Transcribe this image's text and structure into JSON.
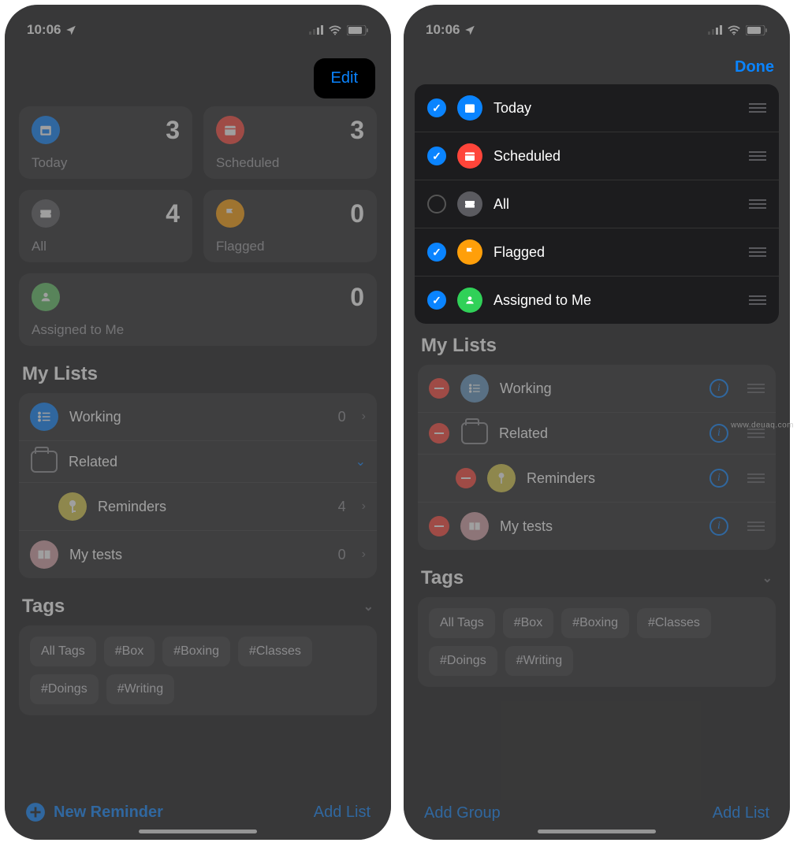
{
  "status": {
    "time": "10:06"
  },
  "left": {
    "nav": {
      "edit": "Edit"
    },
    "cards": {
      "today": {
        "label": "Today",
        "count": "3",
        "color": "#0a84ff"
      },
      "scheduled": {
        "label": "Scheduled",
        "count": "3",
        "color": "#ff453a"
      },
      "all": {
        "label": "All",
        "count": "4",
        "color": "#5b5b60"
      },
      "flagged": {
        "label": "Flagged",
        "count": "0",
        "color": "#ff9f0a"
      },
      "assigned": {
        "label": "Assigned to Me",
        "count": "0",
        "color": "#63c466"
      }
    },
    "mylists_title": "My Lists",
    "lists": {
      "working": {
        "label": "Working",
        "count": "0",
        "color": "#0a84ff"
      },
      "related": {
        "label": "Related"
      },
      "reminders": {
        "label": "Reminders",
        "count": "4",
        "color": "#d9c94a"
      },
      "mytests": {
        "label": "My tests",
        "count": "0",
        "color": "#d8a3a8"
      }
    },
    "tags_title": "Tags",
    "tags": [
      "All Tags",
      "#Box",
      "#Boxing",
      "#Classes",
      "#Doings",
      "#Writing"
    ],
    "bottom": {
      "new_reminder": "New Reminder",
      "add_list": "Add List"
    }
  },
  "right": {
    "nav": {
      "done": "Done"
    },
    "smart_lists": [
      {
        "key": "today",
        "label": "Today",
        "checked": true,
        "color": "#0a84ff"
      },
      {
        "key": "scheduled",
        "label": "Scheduled",
        "checked": true,
        "color": "#ff453a"
      },
      {
        "key": "all",
        "label": "All",
        "checked": false,
        "color": "#5b5b60"
      },
      {
        "key": "flagged",
        "label": "Flagged",
        "checked": true,
        "color": "#ff9f0a"
      },
      {
        "key": "assigned",
        "label": "Assigned to Me",
        "checked": true,
        "color": "#30d158"
      }
    ],
    "mylists_title": "My Lists",
    "lists": [
      {
        "key": "working",
        "label": "Working",
        "color": "#6597c3",
        "type": "list"
      },
      {
        "key": "related",
        "label": "Related",
        "type": "folder"
      },
      {
        "key": "reminders",
        "label": "Reminders",
        "color": "#d9c94a",
        "type": "list",
        "indent": true
      },
      {
        "key": "mytests",
        "label": "My tests",
        "color": "#d8a3a8",
        "type": "list"
      }
    ],
    "tags_title": "Tags",
    "tags": [
      "All Tags",
      "#Box",
      "#Boxing",
      "#Classes",
      "#Doings",
      "#Writing"
    ],
    "bottom": {
      "add_group": "Add Group",
      "add_list": "Add List"
    }
  },
  "watermark": "www.deuaq.com"
}
